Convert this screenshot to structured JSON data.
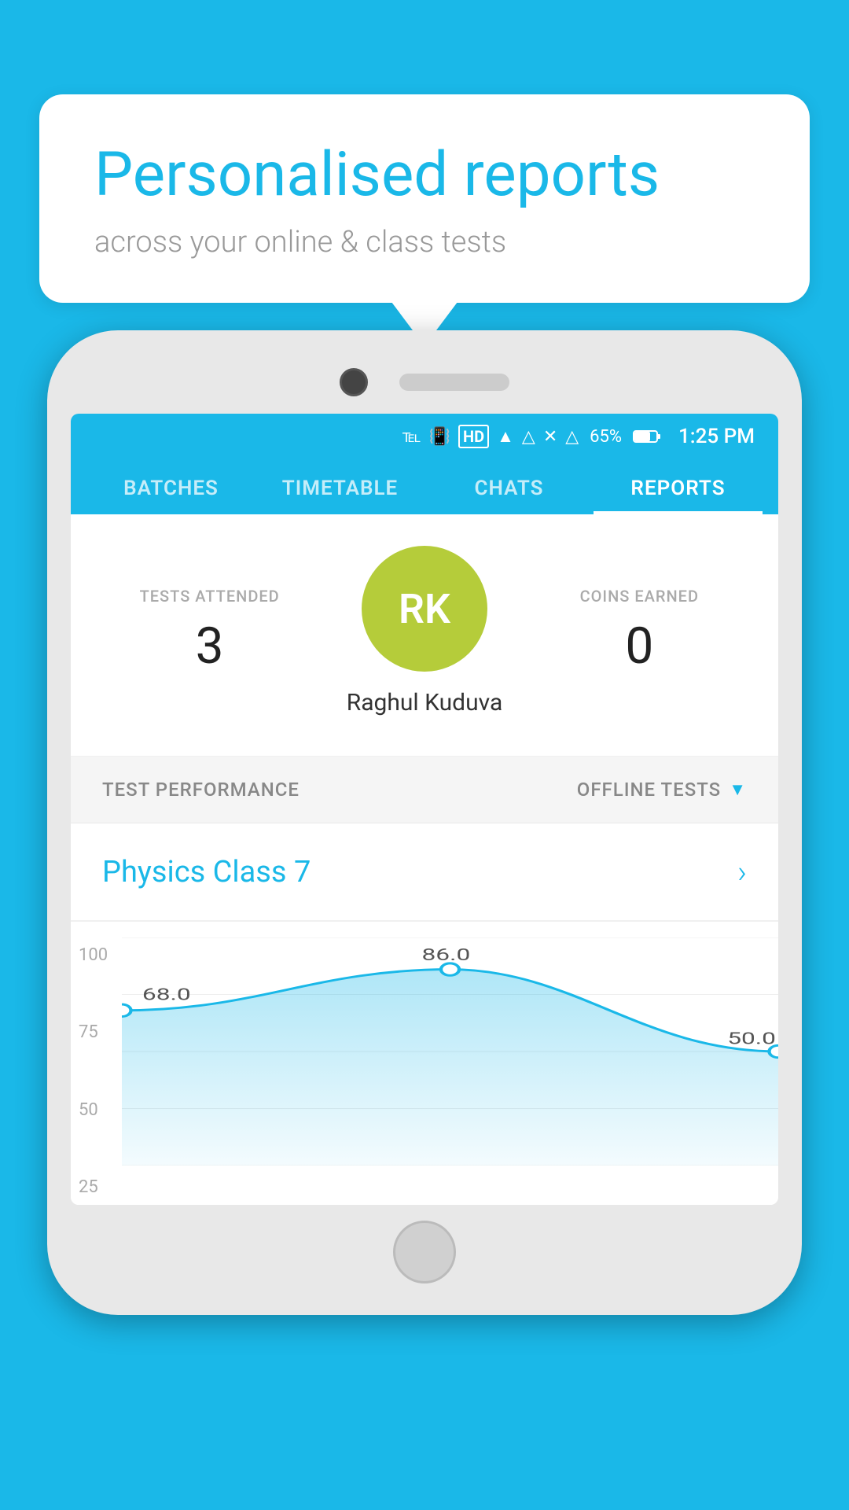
{
  "background_color": "#1ab8e8",
  "bubble": {
    "title": "Personalised reports",
    "subtitle": "across your online & class tests"
  },
  "status_bar": {
    "battery": "65%",
    "time": "1:25 PM",
    "icons": "🔵 📳 HD ▲ 📶 ✕ 📶"
  },
  "nav": {
    "tabs": [
      {
        "label": "BATCHES",
        "active": false
      },
      {
        "label": "TIMETABLE",
        "active": false
      },
      {
        "label": "CHATS",
        "active": false
      },
      {
        "label": "REPORTS",
        "active": true
      }
    ]
  },
  "profile": {
    "avatar_initials": "RK",
    "avatar_bg": "#b5cc3a",
    "name": "Raghul Kuduva",
    "tests_attended_label": "TESTS ATTENDED",
    "tests_attended_value": "3",
    "coins_earned_label": "COINS EARNED",
    "coins_earned_value": "0"
  },
  "performance": {
    "label": "TEST PERFORMANCE",
    "filter_label": "OFFLINE TESTS"
  },
  "class_row": {
    "name": "Physics Class 7"
  },
  "chart": {
    "y_labels": [
      "100",
      "75",
      "50",
      "25"
    ],
    "data_points": [
      {
        "label": "68.0",
        "value": 68
      },
      {
        "label": "86.0",
        "value": 86
      },
      {
        "label": "50.0",
        "value": 50
      }
    ]
  }
}
